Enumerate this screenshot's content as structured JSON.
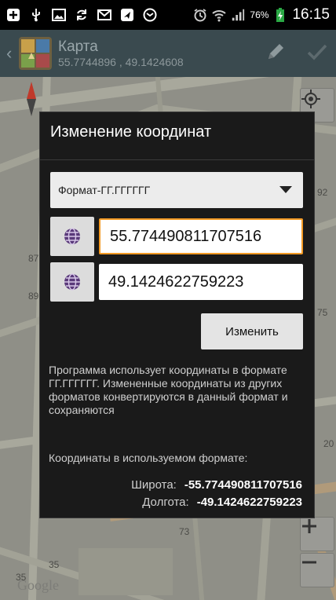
{
  "status_bar": {
    "battery_percent": "76%",
    "time": "16:15"
  },
  "action_bar": {
    "title": "Карта",
    "subtitle": "55.7744896 , 49.1424608"
  },
  "map": {
    "labels": [
      "87",
      "89",
      "92",
      "75",
      "73",
      "35",
      "35",
      "20"
    ],
    "attribution": "Google"
  },
  "dialog": {
    "title": "Изменение координат",
    "format_select": {
      "selected": "Формат-ГГ.ГГГГГГ"
    },
    "latitude_input": {
      "value": "55.774490811707516"
    },
    "longitude_input": {
      "value": "49.1424622759223"
    },
    "change_button": "Изменить",
    "info_text": "Программа использует координаты в формате ГГ.ГГГГГГ. Измененные координаты из других форматов конвертируются в данный формат и сохраняются",
    "current_format_label": "Координаты в используемом формате:",
    "latitude": {
      "label": "Широта:",
      "value": "-55.774490811707516"
    },
    "longitude": {
      "label": "Долгота:",
      "value": "-49.1424622759223"
    }
  }
}
